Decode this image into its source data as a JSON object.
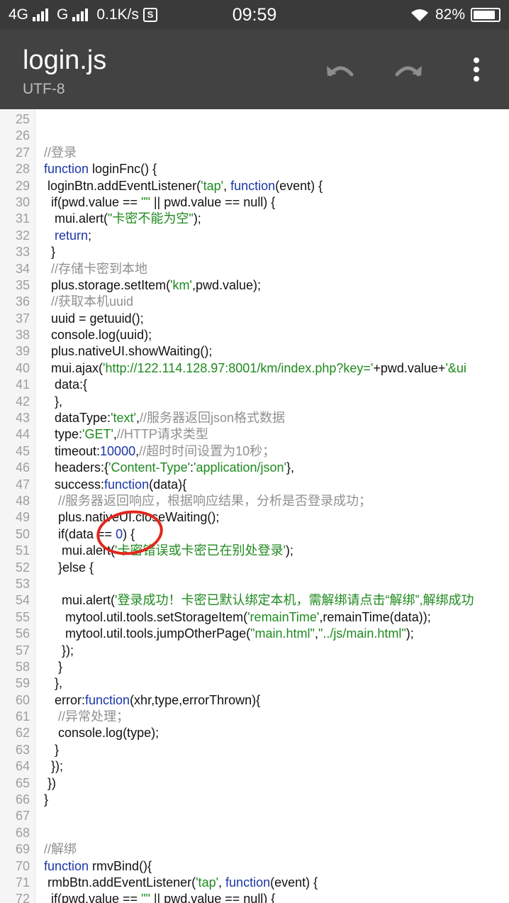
{
  "status_bar": {
    "network_1": "4G",
    "network_2": "G",
    "speed": "0.1K/s",
    "time": "09:59",
    "battery": "82%"
  },
  "toolbar": {
    "title": "login.js",
    "encoding": "UTF-8",
    "undo_icon": "undo-icon",
    "redo_icon": "redo-icon",
    "more_icon": "more-vert-icon"
  },
  "editor": {
    "lines": [
      {
        "n": "25",
        "tokens": []
      },
      {
        "n": "26",
        "tokens": []
      },
      {
        "n": "27",
        "tokens": [
          {
            "t": "cmt",
            "v": "//登录"
          }
        ]
      },
      {
        "n": "28",
        "tokens": [
          {
            "t": "kw",
            "v": "function"
          },
          {
            "t": "plain",
            "v": " loginFnc() {"
          }
        ]
      },
      {
        "n": "29",
        "tokens": [
          {
            "t": "plain",
            "v": " loginBtn.addEventListener("
          },
          {
            "t": "str",
            "v": "'tap'"
          },
          {
            "t": "plain",
            "v": ", "
          },
          {
            "t": "kw",
            "v": "function"
          },
          {
            "t": "plain",
            "v": "(event) {"
          }
        ]
      },
      {
        "n": "30",
        "tokens": [
          {
            "t": "plain",
            "v": "  if(pwd.value == "
          },
          {
            "t": "str",
            "v": "\"\""
          },
          {
            "t": "plain",
            "v": " || pwd.value == null) {"
          }
        ]
      },
      {
        "n": "31",
        "tokens": [
          {
            "t": "plain",
            "v": "   mui.alert("
          },
          {
            "t": "str",
            "v": "\"卡密不能为空\""
          },
          {
            "t": "plain",
            "v": ");"
          }
        ]
      },
      {
        "n": "32",
        "tokens": [
          {
            "t": "kw",
            "v": "   return"
          },
          {
            "t": "plain",
            "v": ";"
          }
        ]
      },
      {
        "n": "33",
        "tokens": [
          {
            "t": "plain",
            "v": "  }"
          }
        ]
      },
      {
        "n": "34",
        "tokens": [
          {
            "t": "cmt",
            "v": "  //存储卡密到本地"
          }
        ]
      },
      {
        "n": "35",
        "tokens": [
          {
            "t": "plain",
            "v": "  plus.storage.setItem("
          },
          {
            "t": "str",
            "v": "'km'"
          },
          {
            "t": "plain",
            "v": ",pwd.value);"
          }
        ]
      },
      {
        "n": "36",
        "tokens": [
          {
            "t": "cmt",
            "v": "  //获取本机uuid"
          }
        ]
      },
      {
        "n": "37",
        "tokens": [
          {
            "t": "plain",
            "v": "  uuid = getuuid();"
          }
        ]
      },
      {
        "n": "38",
        "tokens": [
          {
            "t": "plain",
            "v": "  console.log(uuid);"
          }
        ]
      },
      {
        "n": "39",
        "tokens": [
          {
            "t": "plain",
            "v": "  plus.nativeUI.showWaiting();"
          }
        ]
      },
      {
        "n": "40",
        "tokens": [
          {
            "t": "plain",
            "v": "  mui.ajax("
          },
          {
            "t": "str",
            "v": "'http://122.114.128.97:8001/km/index.php?key='"
          },
          {
            "t": "plain",
            "v": "+pwd.value+"
          },
          {
            "t": "str",
            "v": "'&ui"
          }
        ]
      },
      {
        "n": "41",
        "tokens": [
          {
            "t": "plain",
            "v": "   data:{"
          }
        ]
      },
      {
        "n": "42",
        "tokens": [
          {
            "t": "plain",
            "v": "   },"
          }
        ]
      },
      {
        "n": "43",
        "tokens": [
          {
            "t": "plain",
            "v": "   dataType:"
          },
          {
            "t": "str",
            "v": "'text'"
          },
          {
            "t": "plain",
            "v": ","
          },
          {
            "t": "cmt",
            "v": "//服务器返回json格式数据"
          }
        ]
      },
      {
        "n": "44",
        "tokens": [
          {
            "t": "plain",
            "v": "   type:"
          },
          {
            "t": "str",
            "v": "'GET'"
          },
          {
            "t": "plain",
            "v": ","
          },
          {
            "t": "cmt",
            "v": "//HTTP请求类型"
          }
        ]
      },
      {
        "n": "45",
        "tokens": [
          {
            "t": "plain",
            "v": "   timeout:"
          },
          {
            "t": "num",
            "v": "10000"
          },
          {
            "t": "plain",
            "v": ","
          },
          {
            "t": "cmt",
            "v": "//超时时间设置为10秒；"
          }
        ]
      },
      {
        "n": "46",
        "tokens": [
          {
            "t": "plain",
            "v": "   headers:{"
          },
          {
            "t": "str",
            "v": "'Content-Type'"
          },
          {
            "t": "plain",
            "v": ":"
          },
          {
            "t": "str",
            "v": "'application/json'"
          },
          {
            "t": "plain",
            "v": "},"
          }
        ]
      },
      {
        "n": "47",
        "tokens": [
          {
            "t": "plain",
            "v": "   success:"
          },
          {
            "t": "kw",
            "v": "function"
          },
          {
            "t": "plain",
            "v": "(data){"
          }
        ]
      },
      {
        "n": "48",
        "tokens": [
          {
            "t": "cmt",
            "v": "    //服务器返回响应，根据响应结果，分析是否登录成功；"
          }
        ]
      },
      {
        "n": "49",
        "tokens": [
          {
            "t": "plain",
            "v": "    plus.nativeUI.closeWaiting();"
          }
        ]
      },
      {
        "n": "50",
        "tokens": [
          {
            "t": "plain",
            "v": "    if(data == "
          },
          {
            "t": "num",
            "v": "0"
          },
          {
            "t": "plain",
            "v": ") {"
          }
        ]
      },
      {
        "n": "51",
        "tokens": [
          {
            "t": "plain",
            "v": "     mui.alert("
          },
          {
            "t": "str",
            "v": "'卡密错误或卡密已在别处登录'"
          },
          {
            "t": "plain",
            "v": ");"
          }
        ]
      },
      {
        "n": "52",
        "tokens": [
          {
            "t": "plain",
            "v": "    }else {"
          }
        ]
      },
      {
        "n": "53",
        "tokens": []
      },
      {
        "n": "54",
        "tokens": [
          {
            "t": "plain",
            "v": "     mui.alert("
          },
          {
            "t": "str",
            "v": "'登录成功！卡密已默认绑定本机，需解绑请点击“解绑”,解绑成功"
          }
        ]
      },
      {
        "n": "55",
        "tokens": [
          {
            "t": "plain",
            "v": "      mytool.util.tools.setStorageItem("
          },
          {
            "t": "str",
            "v": "'remainTime'"
          },
          {
            "t": "plain",
            "v": ",remainTime(data));"
          }
        ]
      },
      {
        "n": "56",
        "tokens": [
          {
            "t": "plain",
            "v": "      mytool.util.tools.jumpOtherPage("
          },
          {
            "t": "str",
            "v": "\"main.html\""
          },
          {
            "t": "plain",
            "v": ","
          },
          {
            "t": "str",
            "v": "\"../js/main.html\""
          },
          {
            "t": "plain",
            "v": ");"
          }
        ]
      },
      {
        "n": "57",
        "tokens": [
          {
            "t": "plain",
            "v": "     });"
          }
        ]
      },
      {
        "n": "58",
        "tokens": [
          {
            "t": "plain",
            "v": "    }"
          }
        ]
      },
      {
        "n": "59",
        "tokens": [
          {
            "t": "plain",
            "v": "   },"
          }
        ]
      },
      {
        "n": "60",
        "tokens": [
          {
            "t": "plain",
            "v": "   error:"
          },
          {
            "t": "kw",
            "v": "function"
          },
          {
            "t": "plain",
            "v": "(xhr,type,errorThrown){"
          }
        ]
      },
      {
        "n": "61",
        "tokens": [
          {
            "t": "cmt",
            "v": "    //异常处理；"
          }
        ]
      },
      {
        "n": "62",
        "tokens": [
          {
            "t": "plain",
            "v": "    console.log(type);"
          }
        ]
      },
      {
        "n": "63",
        "tokens": [
          {
            "t": "plain",
            "v": "   }"
          }
        ]
      },
      {
        "n": "64",
        "tokens": [
          {
            "t": "plain",
            "v": "  });"
          }
        ]
      },
      {
        "n": "65",
        "tokens": [
          {
            "t": "plain",
            "v": " })"
          }
        ]
      },
      {
        "n": "66",
        "tokens": [
          {
            "t": "plain",
            "v": "}"
          }
        ]
      },
      {
        "n": "67",
        "tokens": []
      },
      {
        "n": "68",
        "tokens": []
      },
      {
        "n": "69",
        "tokens": [
          {
            "t": "cmt",
            "v": "//解绑"
          }
        ]
      },
      {
        "n": "70",
        "tokens": [
          {
            "t": "kw",
            "v": "function"
          },
          {
            "t": "plain",
            "v": " rmvBind(){"
          }
        ]
      },
      {
        "n": "71",
        "tokens": [
          {
            "t": "plain",
            "v": " rmbBtn.addEventListener("
          },
          {
            "t": "str",
            "v": "'tap'"
          },
          {
            "t": "plain",
            "v": ", "
          },
          {
            "t": "kw",
            "v": "function"
          },
          {
            "t": "plain",
            "v": "(event) {"
          }
        ]
      },
      {
        "n": "72",
        "tokens": [
          {
            "t": "plain",
            "v": "  if(pwd.value == "
          },
          {
            "t": "str",
            "v": "\"\""
          },
          {
            "t": "plain",
            "v": " || pwd.value == null) {"
          }
        ]
      }
    ]
  },
  "colors": {
    "keyword": "#1a36a8",
    "string": "#1f8a1f",
    "comment": "#909090",
    "annotation": "#e0281f"
  }
}
